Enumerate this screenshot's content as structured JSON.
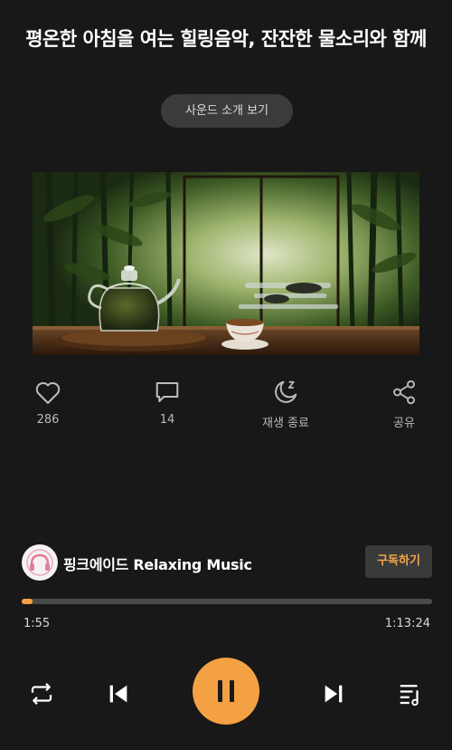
{
  "header": {
    "title": "평온한 아침을 여는 힐링음악, 잔잔한 물소리와 함께",
    "intro_button": "사운드 소개 보기"
  },
  "actions": [
    {
      "icon": "heart-icon",
      "label": "286"
    },
    {
      "icon": "comment-icon",
      "label": "14"
    },
    {
      "icon": "sleep-timer-icon",
      "label": "재생 종료"
    },
    {
      "icon": "share-icon",
      "label": "공유"
    }
  ],
  "channel": {
    "name": "핑크에이드 Relaxing Music",
    "subscribe_label": "구독하기"
  },
  "player": {
    "elapsed": "1:55",
    "duration": "1:13:24",
    "progress_fraction": 0.026
  },
  "controls": {
    "repeat_icon": "repeat-icon",
    "previous_icon": "skip-previous-icon",
    "pause_icon": "pause-icon",
    "next_icon": "skip-next-icon",
    "playlist_icon": "playlist-icon"
  },
  "colors": {
    "background": "#181818",
    "accent": "#f4a143",
    "muted_text": "#b9b9b9"
  }
}
